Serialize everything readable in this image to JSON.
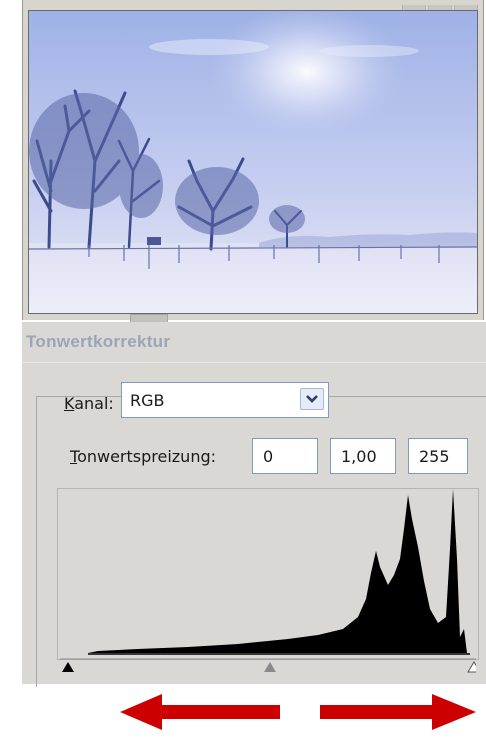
{
  "dialog": {
    "title": "Tonwertkorrektur",
    "channel": {
      "label": "Kanal:",
      "mnemonic": "K",
      "label_rest": "anal:",
      "value": "RGB"
    },
    "input_levels": {
      "label": "Tonwertspreizung:",
      "mnemonic": "T",
      "label_rest": "onwertspreizung:",
      "black": "0",
      "gamma": "1,00",
      "white": "255"
    },
    "slider_positions": {
      "black_point": 0,
      "gamma_point": 0.5,
      "white_point": 1
    }
  },
  "colors": {
    "dialog_bg": "#d9d8d4",
    "title_text": "#9aa5b9",
    "annotation_arrow": "#cc0000",
    "histogram_fill": "#000000"
  },
  "icons": {
    "dropdown": "chevron-down-icon",
    "black_slider": "black-triangle-icon",
    "gamma_slider": "gray-triangle-icon",
    "white_slider": "white-triangle-icon",
    "left_arrow": "arrow-left-icon",
    "right_arrow": "arrow-right-icon"
  }
}
